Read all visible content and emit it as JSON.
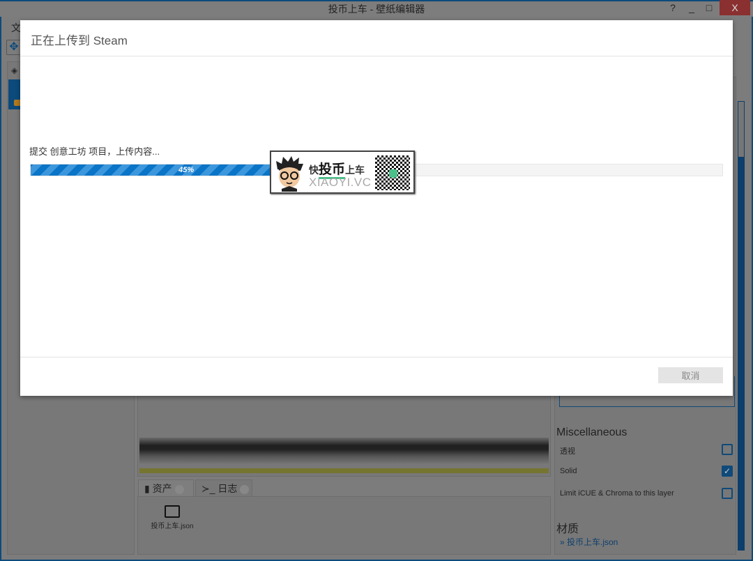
{
  "app": {
    "title": "投币上车 - 壁纸编辑器",
    "help_label": "?",
    "minimize_label": "_",
    "maximize_label": "□",
    "close_label": "X",
    "menu_first": "文"
  },
  "bottom_tabs": [
    {
      "label": "资产",
      "icon": "copy-icon"
    },
    {
      "label": "日志",
      "icon": "terminal-icon"
    }
  ],
  "assets": [
    {
      "name": "投币上车.json",
      "icon": "image-icon"
    }
  ],
  "properties": {
    "section_title": "Miscellaneous",
    "items": [
      {
        "label": "透视",
        "checked": false
      },
      {
        "label": "Solid",
        "checked": true
      },
      {
        "label": "Limit iCUE & Chroma to this layer",
        "checked": false
      }
    ],
    "material_title": "材质",
    "material_link": "» 投币上车.json"
  },
  "dialog": {
    "title": "正在上传到 Steam",
    "status": "提交 创意工坊 项目，上传内容...",
    "progress_percent": 45,
    "progress_label": "45%",
    "cancel_label": "取消"
  },
  "watermark": {
    "line1_prefix": "快",
    "line1_bold": "投币",
    "line1_suffix": "上车",
    "line2": "XIAOYI.VC"
  },
  "colors": {
    "accent": "#0a74c7",
    "app_blue": "#0c4a7c"
  }
}
